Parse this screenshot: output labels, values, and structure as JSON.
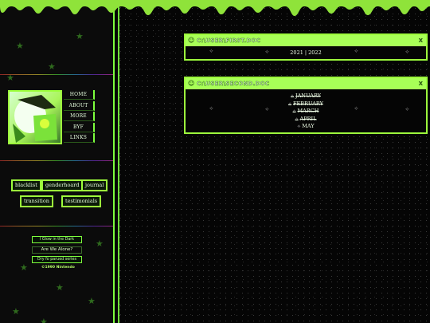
{
  "sidebar": {
    "nav": [
      "HOME",
      "ABOUT",
      "MORE",
      "BYF",
      "LINKS"
    ],
    "tags": [
      "blacklist",
      "genderhoard",
      "journal",
      "transition",
      "testimonials"
    ],
    "badges": [
      {
        "text": "I Glow in the Dark"
      },
      {
        "text": "Are We Alone?"
      },
      {
        "text": "Dry fo parued series"
      }
    ],
    "copyright": "©1990 Nintendo"
  },
  "windows": [
    {
      "title": "C:\\USER\\FIRST.DOC",
      "body": [
        "2021 | 2022"
      ]
    },
    {
      "title": "C:\\USER\\SECOND.DOC",
      "months": [
        {
          "name": "JANUARY",
          "struck": true
        },
        {
          "name": "FEBRUARY",
          "struck": true
        },
        {
          "name": "MARCH",
          "struck": true
        },
        {
          "name": "APRIL",
          "struck": true
        },
        {
          "name": "MAY",
          "struck": false
        }
      ]
    }
  ],
  "colors": {
    "accent": "#9dff3c",
    "background": "#050505"
  },
  "icons": {
    "window": "folder-icon",
    "close": "close-icon",
    "sparkle": "sparkle-icon"
  }
}
